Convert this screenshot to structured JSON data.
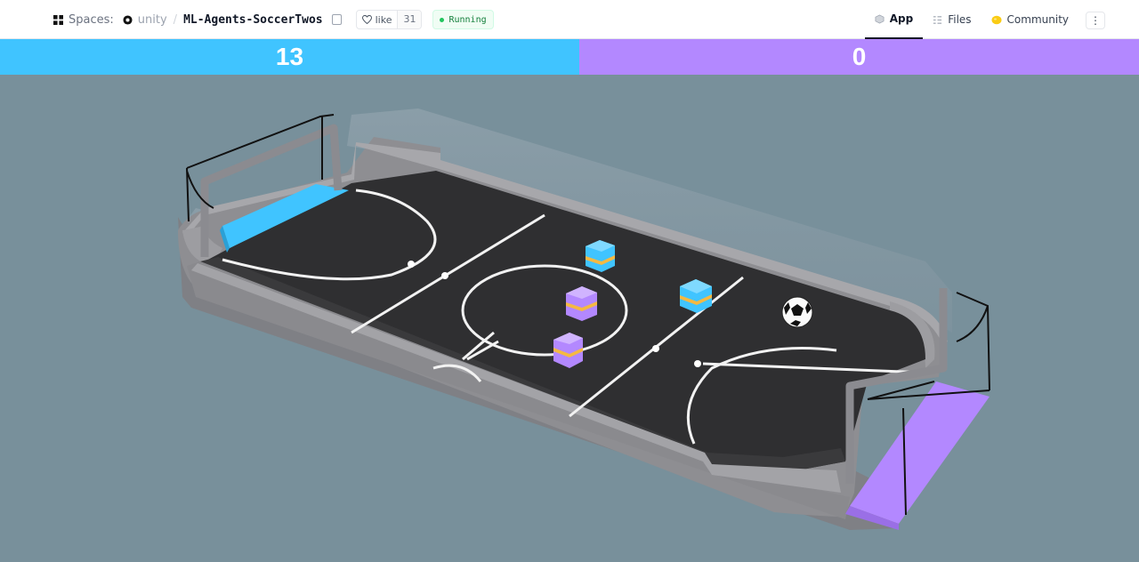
{
  "header": {
    "spaces_label": "Spaces:",
    "org": "unity",
    "separator": "/",
    "repo": "ML-Agents-SoccerTwos",
    "like_label": "like",
    "like_count": "31",
    "status": "Running"
  },
  "nav": {
    "app": "App",
    "files": "Files",
    "community": "Community",
    "more": "⋮"
  },
  "scoreboard": {
    "blue_score": "13",
    "purple_score": "0",
    "blue_color": "#40c4ff",
    "purple_color": "#b388ff"
  },
  "scene": {
    "icons": [
      "cube-icon",
      "files-icon",
      "community-icon",
      "heart-icon",
      "copy-icon",
      "spaces-logo-icon",
      "unity-logo-icon"
    ],
    "field_color": "#2f2f31",
    "wall_color": "#8e8e92",
    "ball": "soccer-ball"
  }
}
